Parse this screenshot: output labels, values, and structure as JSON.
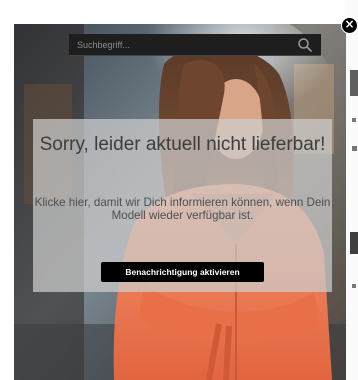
{
  "search": {
    "placeholder": "Suchbegriff...",
    "value": "",
    "icon": "search-icon"
  },
  "modal": {
    "close_icon": "close-icon",
    "close_label": "×",
    "background_image": "model-photo"
  },
  "notice": {
    "title": "Sorry, leider aktuell nicht lieferbar!",
    "text": "Klicke hier, damit wir Dich informieren können, wenn Dein Modell wieder verfügbar ist.",
    "button_label": "Benachrichtigung aktivieren"
  },
  "colors": {
    "overlay_panel": "#cdcdcd",
    "button_bg": "#000000",
    "button_text": "#ffffff",
    "title_text": "#3d3d3d",
    "jacket": "#f07b55"
  }
}
